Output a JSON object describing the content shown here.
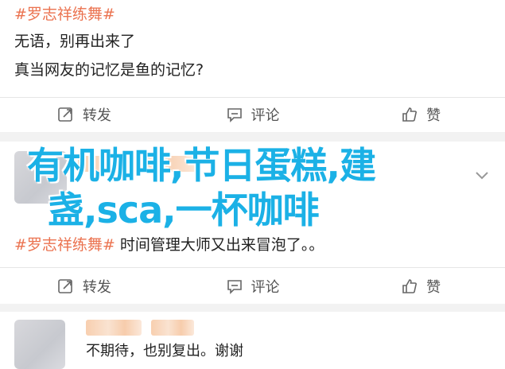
{
  "post1": {
    "hashtag": "#罗志祥练舞#",
    "line1": "无语，别再出来了",
    "line2": "真当网友的记忆是鱼的记忆?"
  },
  "actions1": {
    "repost": "转发",
    "comment": "评论",
    "like": "赞"
  },
  "overlay": {
    "line1": "有机咖啡,节日蛋糕,建",
    "line2": "盏,sca,一杯咖啡"
  },
  "post2": {
    "hashtag": "#罗志祥练舞#",
    "text": " 时间管理大师又出来冒泡了。。"
  },
  "actions2": {
    "repost": "转发",
    "comment": "评论",
    "like": "赞"
  },
  "post3": {
    "text": "不期待，也别复出。谢谢"
  },
  "colors": {
    "hashtag": "#eb7350",
    "overlay": "#1bb1e6"
  }
}
